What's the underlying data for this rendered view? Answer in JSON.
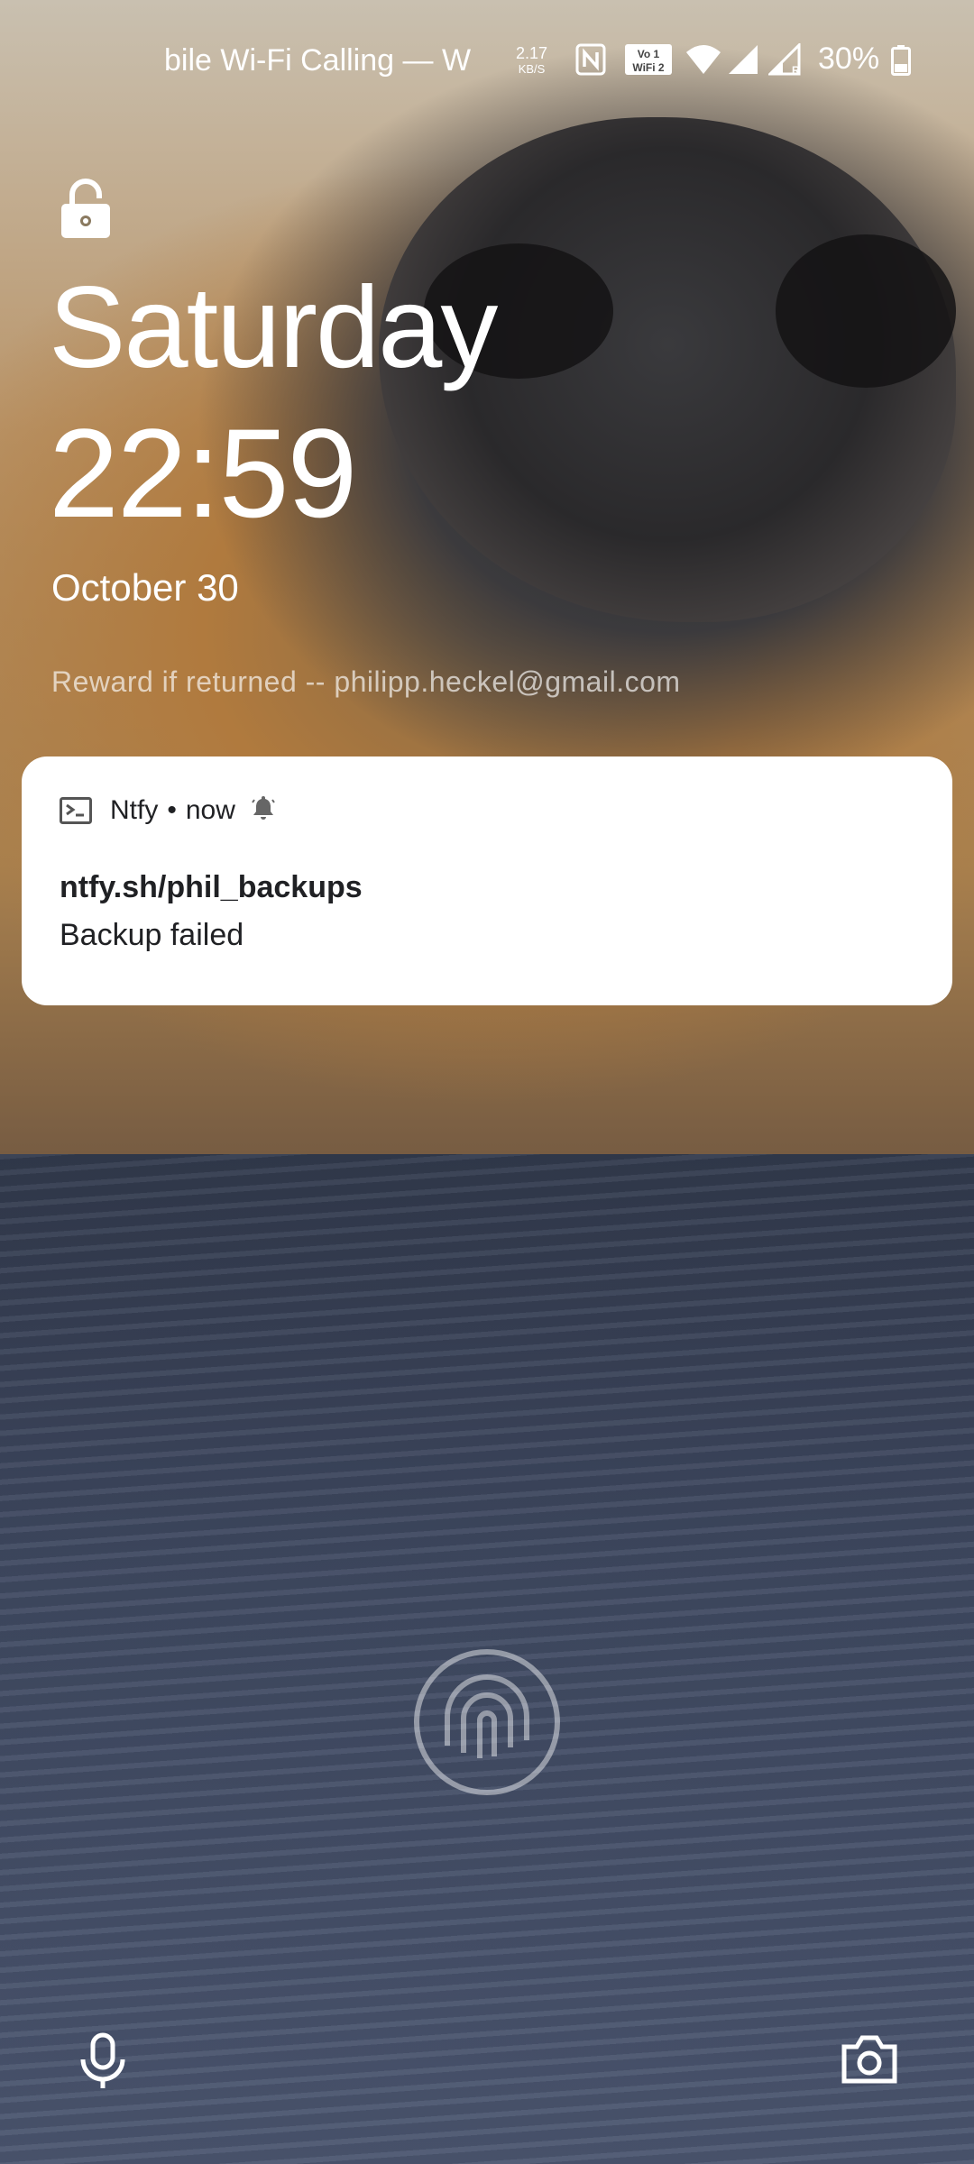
{
  "status_bar": {
    "carrier_text": "bile Wi-Fi Calling — W",
    "net_speed_value": "2.17",
    "net_speed_unit": "KB/S",
    "volte_badge": "Vo WiFi 2",
    "battery_percent": "30%"
  },
  "lockscreen": {
    "day": "Saturday",
    "time": "22:59",
    "date": "October 30",
    "owner_info": "Reward if returned -- philipp.heckel@gmail.com"
  },
  "notification": {
    "app_name": "Ntfy",
    "separator": "•",
    "when": "now",
    "title": "ntfy.sh/phil_backups",
    "message": "Backup failed"
  },
  "icons": {
    "lock": "lock-open-icon",
    "fingerprint": "fingerprint-icon",
    "voice": "microphone-icon",
    "camera": "camera-icon"
  }
}
